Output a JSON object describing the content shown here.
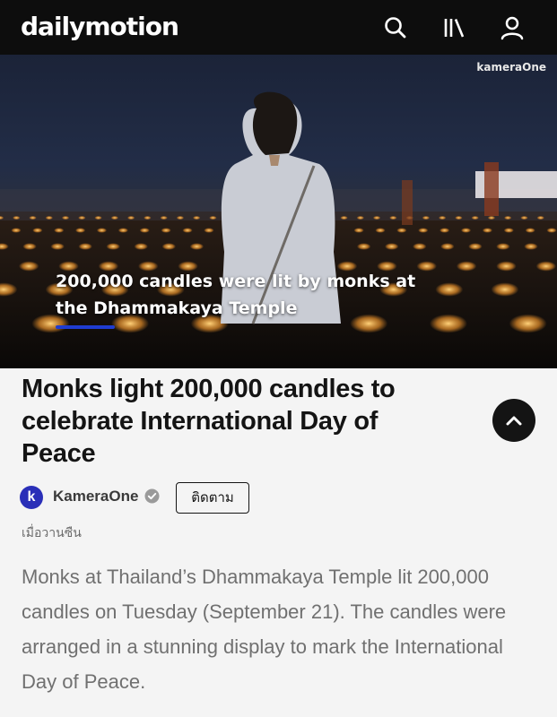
{
  "header": {
    "logo": "dailymotion",
    "icons": [
      "search-icon",
      "library-icon",
      "account-icon"
    ]
  },
  "video": {
    "watermark": "kameraOne",
    "caption": "200,000 candles were lit by monks at the Dhammakaya Temple",
    "accent_color": "#1f3cd1"
  },
  "article": {
    "title": "Monks light 200,000 candles to celebrate International Day of Peace",
    "collapse_icon": "chevron-up-icon",
    "channel": {
      "avatar_letter": "k",
      "name": "KameraOne",
      "verified_icon": "verified-check-icon",
      "follow_label": "ติดตาม"
    },
    "posted": "เมื่อวานซืน",
    "description": "Monks at Thailand’s Dhammakaya Temple lit 200,000 candles on Tuesday (September 21). The candles were arranged in a stunning display to mark the International Day of Peace."
  }
}
